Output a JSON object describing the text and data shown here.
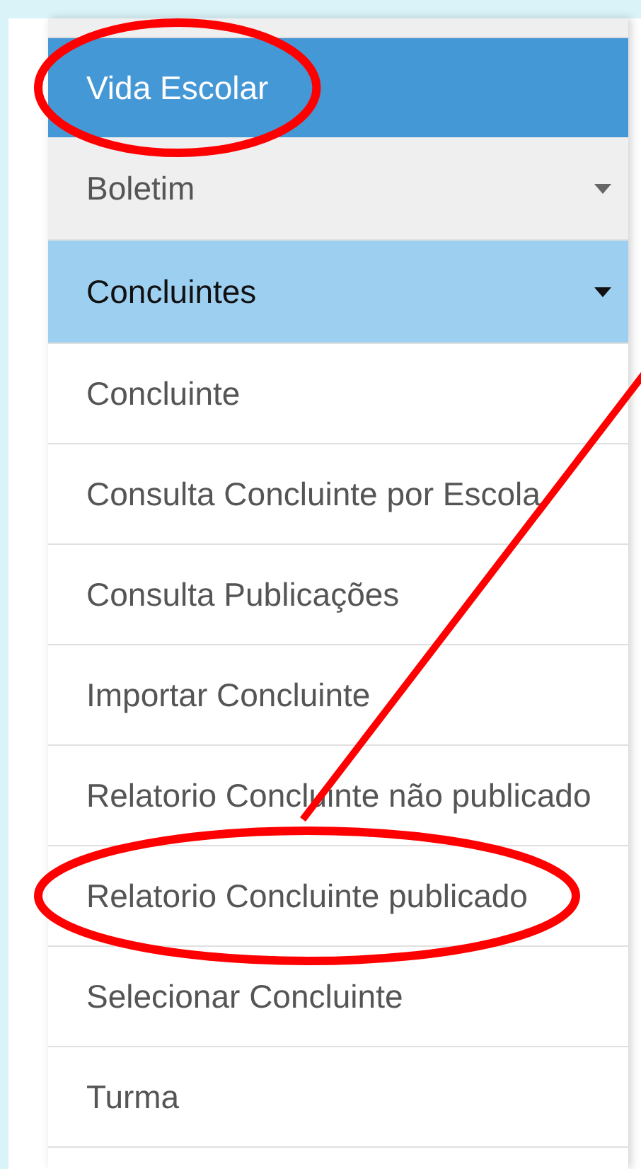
{
  "header": {
    "label": "Vida Escolar",
    "circled": true
  },
  "menu": [
    {
      "label": "Boletim",
      "selected": false,
      "expanded": false
    },
    {
      "label": "Concluintes",
      "selected": true,
      "expanded": true,
      "children": [
        {
          "label": "Concluinte",
          "circled": false
        },
        {
          "label": "Consulta Concluinte por Escola",
          "circled": false
        },
        {
          "label": "Consulta Publicações",
          "circled": false
        },
        {
          "label": "Importar Concluinte",
          "circled": false
        },
        {
          "label": "Relatorio Concluinte não publicado",
          "circled": false
        },
        {
          "label": "Relatorio Concluinte publicado",
          "circled": true
        },
        {
          "label": "Selecionar Concluinte",
          "circled": false
        },
        {
          "label": "Turma",
          "circled": false
        }
      ]
    }
  ],
  "annotations": [
    {
      "kind": "line"
    }
  ]
}
